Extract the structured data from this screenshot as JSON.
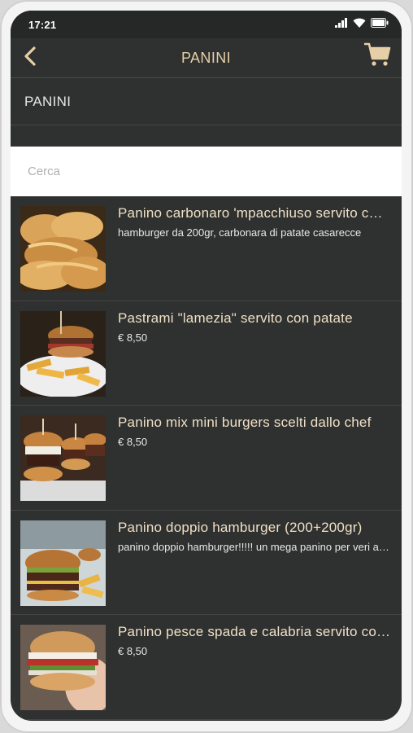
{
  "status_bar": {
    "time": "17:21"
  },
  "header": {
    "title": "PANINI"
  },
  "category": {
    "label": "PANINI"
  },
  "search": {
    "placeholder": "Cerca",
    "value": ""
  },
  "products": [
    {
      "name": "Panino carbonaro 'mpacchiuso servito con patate",
      "detail": "hamburger da 200gr, carbonara di patate casarecce"
    },
    {
      "name": "Pastrami \"lamezia\" servito con patate",
      "detail": "€ 8,50"
    },
    {
      "name": "Panino mix mini burgers scelti dallo chef",
      "detail": "€ 8,50"
    },
    {
      "name": "Panino doppio hamburger (200+200gr)",
      "detail": "panino doppio hamburger!!!!! un mega panino per veri affamati"
    },
    {
      "name": "Panino pesce spada e calabria servito con patate",
      "detail": "€ 8,50"
    }
  ],
  "colors": {
    "background": "#2f3030",
    "accent_gold": "#e6cfa6",
    "status_bar": "#262727"
  },
  "icons": {
    "back": "chevron-left-icon",
    "cart": "shopping-cart-icon"
  }
}
